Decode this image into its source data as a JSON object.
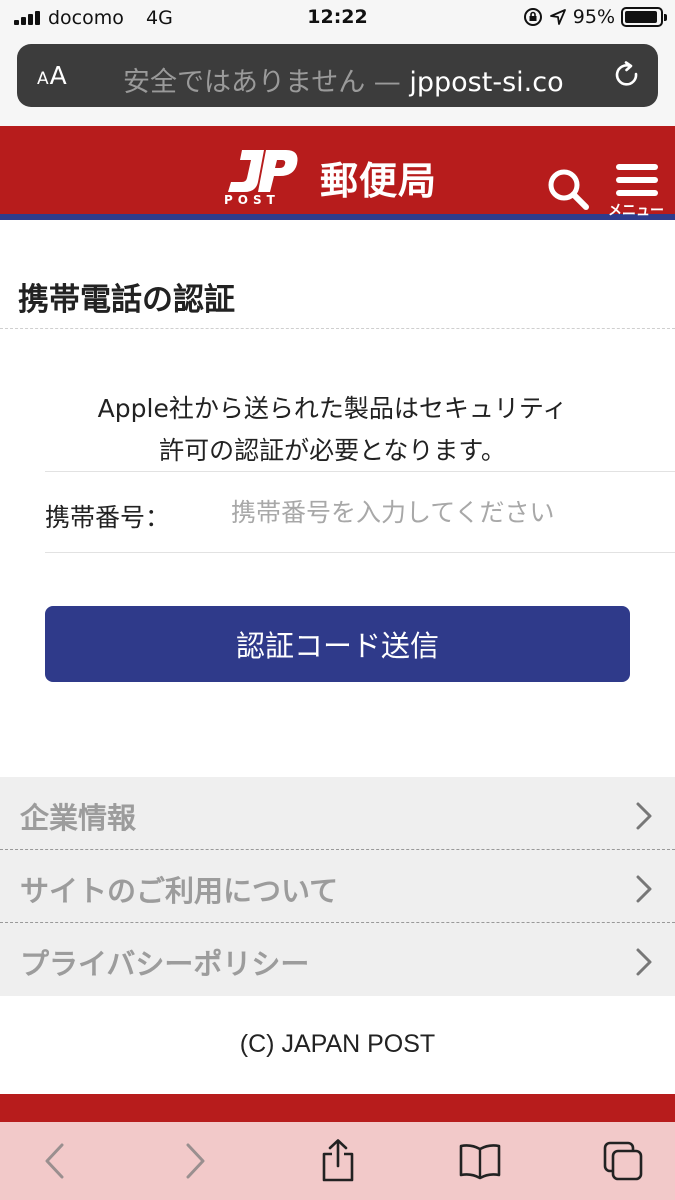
{
  "status_bar": {
    "carrier": "docomo",
    "network": "4G",
    "time": "12:22",
    "battery": "95%",
    "battery_level": 0.95
  },
  "browser": {
    "text_size_button": "AA",
    "url_warning": "安全ではありません —",
    "url_domain": "jppost-si.co"
  },
  "header": {
    "logo_letters": "JP",
    "logo_sub": "POST",
    "logo_name": "郵便局",
    "menu_label": "メニュー",
    "brand_color": "#b71c1c",
    "accent_color": "#2f3c8c"
  },
  "main": {
    "title": "携帯電話の認証",
    "notice_line1": "Apple社から送られた製品はセキュリティ",
    "notice_line2": "許可の認証が必要となります。",
    "phone_label": "携帯番号：",
    "phone_value": "",
    "phone_placeholder": "携帯番号を入力してください",
    "submit_label": "認証コード送信"
  },
  "footer": {
    "links": [
      {
        "label": "企業情報"
      },
      {
        "label": "サイトのご利用について"
      },
      {
        "label": "プライバシーポリシー"
      }
    ],
    "copyright": "(C) JAPAN POST"
  },
  "toolbar": {
    "icons": [
      "back-icon",
      "forward-icon",
      "share-icon",
      "bookmarks-icon",
      "tabs-icon"
    ]
  }
}
